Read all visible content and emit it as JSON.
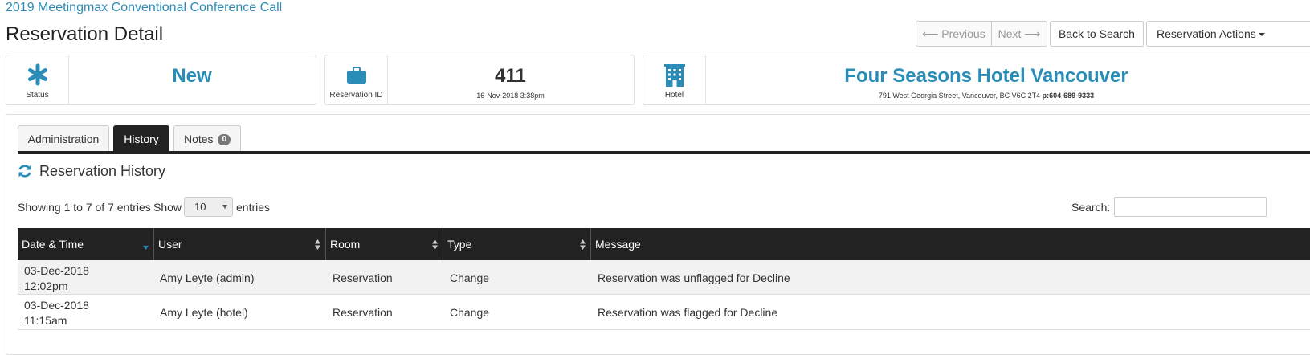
{
  "event_title": "2019 Meetingmax Conventional Conference Call",
  "page_title": "Reservation Detail",
  "nav": {
    "previous": "⟵ Previous",
    "next": "Next ⟶",
    "back": "Back to Search",
    "actions": "Reservation Actions"
  },
  "cards": {
    "status": {
      "icon": "asterisk-icon",
      "caption": "Status",
      "value": "New"
    },
    "reservation": {
      "icon": "briefcase-icon",
      "caption": "Reservation ID",
      "value": "411",
      "sub": "16-Nov-2018 3:38pm"
    },
    "hotel": {
      "icon": "building-icon",
      "caption": "Hotel",
      "value": "Four Seasons Hotel Vancouver",
      "address": "791 West Georgia Street, Vancouver, BC V6C 2T4",
      "phone_label": "p:",
      "phone": "604-689-9333"
    }
  },
  "tabs": [
    {
      "label": "Administration",
      "active": false
    },
    {
      "label": "History",
      "active": true
    },
    {
      "label": "Notes",
      "badge": "0",
      "active": false
    }
  ],
  "section_title": "Reservation History",
  "table_info": {
    "showing": "Showing 1 to 7 of 7 entries",
    "show_label": "Show",
    "page_size": "10",
    "entries_label": "entries",
    "search_label": "Search:",
    "search_value": ""
  },
  "columns": [
    "Date & Time",
    "User",
    "Room",
    "Type",
    "Message"
  ],
  "rows": [
    {
      "date": "03-Dec-2018",
      "time": "12:02pm",
      "user": "Amy Leyte (admin)",
      "room": "Reservation",
      "type": "Change",
      "message": "Reservation was unflagged for Decline"
    },
    {
      "date": "03-Dec-2018",
      "time": "11:15am",
      "user": "Amy Leyte (hotel)",
      "room": "Reservation",
      "type": "Change",
      "message": "Reservation was flagged for Decline"
    }
  ],
  "colors": {
    "accent": "#2a8db8",
    "header_bg": "#222222"
  }
}
